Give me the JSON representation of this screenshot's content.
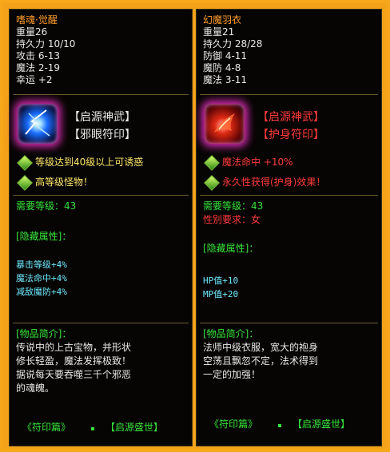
{
  "left": {
    "name": "嗜魂·觉醒",
    "stats": [
      "重量26",
      "持久力 10/10",
      "攻击 6-13",
      "魔法 2-19",
      "幸运 +2"
    ],
    "tags": [
      "【启源神武】",
      "【邪眼符印】"
    ],
    "bullets": [
      "等级达到40级以上可诱惑",
      "高等级怪物！"
    ],
    "required_level": "需要等级：43",
    "hidden_header": "[隐藏属性]：",
    "hidden": [
      "暴击等级+4%",
      "魔法命中+4%",
      "减敌魔防+4%"
    ],
    "intro_header": "[物品简介]：",
    "intro": [
      "传说中的上古宝物，并形状",
      "修长轻盈，魔法发挥极致！",
      "据说每天要吞噬三千个邪恶",
      "的魂魄。"
    ],
    "footer_left": "《符印篇》",
    "footer_right": "【启源盛世】"
  },
  "right": {
    "name": "幻魔羽衣",
    "stats": [
      "重量21",
      "持久力 28/28",
      "防御 4-11",
      "魔防 4-8",
      "魔法 3-11"
    ],
    "tags": [
      "【启源神武】",
      "【护身符印】"
    ],
    "bullets": [
      "魔法命中 +10%",
      "永久性获得(护身)效果！"
    ],
    "required_level": "需要等级：43",
    "gender_req": "性别要求：女",
    "hidden_header": "[隐藏属性]：",
    "hidden": [
      "HP值+10",
      "MP值+20"
    ],
    "intro_header": "[物品简介]：",
    "intro": [
      "法师中级衣服，宽大的袍身",
      "空荡且飘忽不定，法术得到",
      "一定的加强！"
    ],
    "footer_left": "《符印篇》",
    "footer_right": "【启源盛世】"
  },
  "icons": {
    "left": "blue-orb-weapon-icon",
    "right": "red-armor-icon"
  }
}
